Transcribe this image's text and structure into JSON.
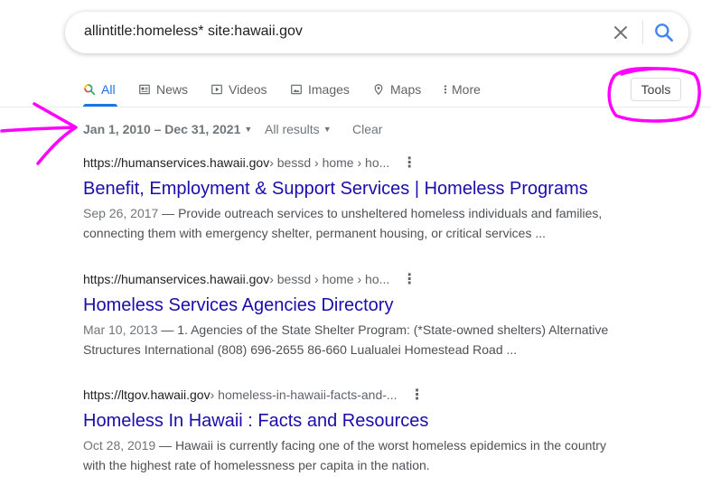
{
  "search": {
    "query": "allintitle:homeless* site:hawaii.gov"
  },
  "tabs": [
    {
      "label": "All",
      "icon": "google-search-multicolor-icon"
    },
    {
      "label": "News",
      "icon": "news-icon"
    },
    {
      "label": "Videos",
      "icon": "video-icon"
    },
    {
      "label": "Images",
      "icon": "image-icon"
    },
    {
      "label": "Maps",
      "icon": "map-pin-icon"
    },
    {
      "label": "More",
      "icon": "vertical-dots-icon"
    }
  ],
  "tools_label": "Tools",
  "filters": {
    "date_range": "Jan 1, 2010 – Dec 31, 2021",
    "results_scope": "All results",
    "clear": "Clear"
  },
  "results": [
    {
      "domain": "https://humanservices.hawaii.gov",
      "breadcrumbs": " › bessd › home › ho...",
      "title": "Benefit, Employment & Support Services | Homeless Programs",
      "date": "Sep 26, 2017",
      "snippet_line1": " — Provide outreach services to unsheltered homeless individuals and families,",
      "snippet_line2": "connecting them with emergency shelter, permanent housing, or critical services ..."
    },
    {
      "domain": "https://humanservices.hawaii.gov",
      "breadcrumbs": " › bessd › home › ho...",
      "title": "Homeless Services Agencies Directory",
      "date": "Mar 10, 2013",
      "snippet_line1": " — 1. Agencies of the State Shelter Program: (*State-owned shelters) Alternative",
      "snippet_line2": "Structures International (808) 696-2655 86-660 Lualualei Homestead Road ..."
    },
    {
      "domain": "https://ltgov.hawaii.gov",
      "breadcrumbs": " › homeless-in-hawaii-facts-and-...",
      "title": "Homeless In Hawaii : Facts and Resources",
      "date": "Oct 28, 2019",
      "snippet_line1": " — Hawaii is currently facing one of the worst homeless epidemics in the country",
      "snippet_line2": "with the highest rate of homelessness per capita in the nation."
    }
  ],
  "colors": {
    "link": "#1a0dab",
    "accent": "#1a73e8",
    "annotation": "#ff00ff"
  }
}
